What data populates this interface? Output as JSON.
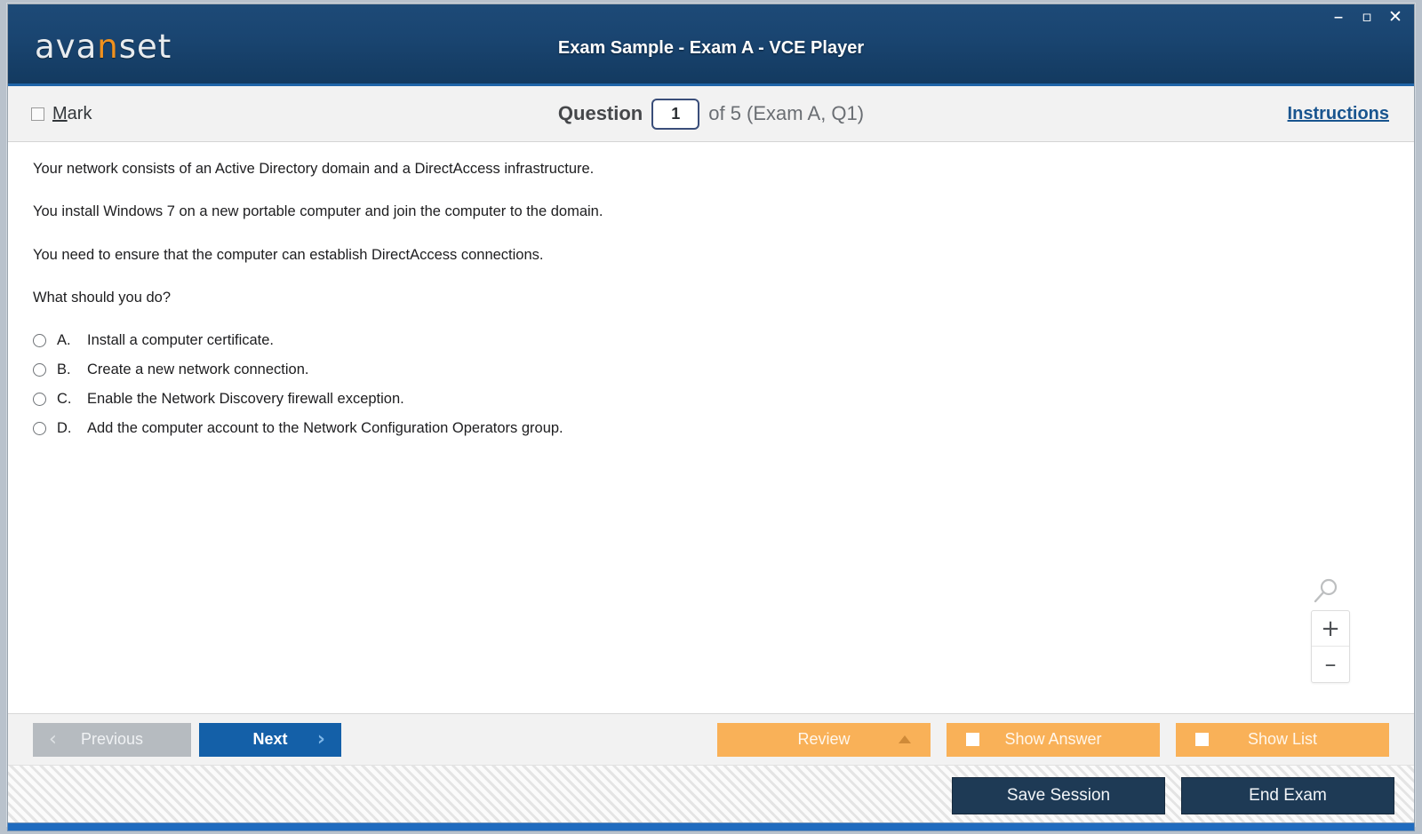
{
  "window": {
    "logo_text_1": "ava",
    "logo_accent": "n",
    "logo_text_2": "set",
    "title": "Exam Sample - Exam A - VCE Player",
    "controls": {
      "minimize": "–",
      "maximize": "▫",
      "close": "✕"
    }
  },
  "question_bar": {
    "mark_label_accel": "M",
    "mark_label_rest": "ark",
    "question_word": "Question",
    "question_number": "1",
    "of_text": "of 5 (Exam A, Q1)",
    "instructions_link": "Instructions"
  },
  "question": {
    "paragraphs": [
      "Your network consists of an Active Directory domain and a DirectAccess infrastructure.",
      "You install Windows 7 on a new portable computer and join the computer to the domain.",
      "You need to ensure that the computer can establish DirectAccess connections.",
      "What should you do?"
    ],
    "options": [
      {
        "letter": "A.",
        "text": "Install a computer certificate."
      },
      {
        "letter": "B.",
        "text": "Create a new network connection."
      },
      {
        "letter": "C.",
        "text": "Enable the Network Discovery firewall exception."
      },
      {
        "letter": "D.",
        "text": "Add the computer account to the Network Configuration Operators group."
      }
    ]
  },
  "zoom_widget": {
    "zoom_in": "+",
    "zoom_out": "–"
  },
  "nav": {
    "previous": "Previous",
    "previous_chevron": "‹",
    "next": "Next",
    "next_chevron": "›",
    "review": "Review",
    "show_answer": "Show Answer",
    "show_list": "Show List"
  },
  "status": {
    "save_session": "Save Session",
    "end_exam": "End Exam"
  },
  "colors": {
    "titlebar": "#1a4571",
    "accent_blue": "#1f64a8",
    "logo_orange": "#f0911e",
    "orange_button": "#f9b158",
    "next_button": "#1460a8",
    "dark_button": "#1e3a55",
    "link_blue": "#19558f"
  }
}
